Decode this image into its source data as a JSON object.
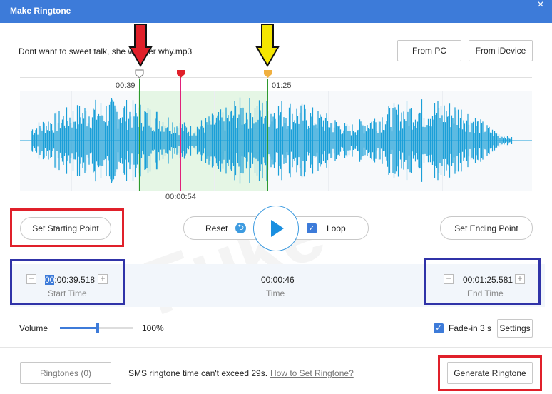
{
  "window": {
    "title": "Make Ringtone",
    "close_glyph": "×"
  },
  "file": {
    "name": "Dont want to sweet talk, she wonder why.mp3"
  },
  "source_buttons": {
    "from_pc": "From PC",
    "from_idevice": "From iDevice"
  },
  "markers": {
    "start_label": "00:39",
    "end_label": "01:25",
    "playhead_label": "00:00:54",
    "start_color": "#2e9a2e",
    "end_color": "#2e9a2e",
    "playhead_color": "#e0202a",
    "end_handle_color": "#f0b040"
  },
  "controls": {
    "set_start": "Set Starting Point",
    "set_end": "Set Ending Point",
    "reset": "Reset",
    "loop": "Loop",
    "loop_checked": true
  },
  "times": {
    "start_value": "00:00:39.518",
    "start_caption": "Start Time",
    "duration_value": "00:00:46",
    "duration_caption": "Time",
    "end_value": "00:01:25.581",
    "end_caption": "End Time",
    "minus": "−",
    "plus": "+"
  },
  "volume": {
    "label": "Volume",
    "value_text": "100%",
    "level": 0.52
  },
  "fade": {
    "label": "Fade-in 3 s",
    "checked": true,
    "settings": "Settings"
  },
  "footer": {
    "ringtones": "Ringtones (0)",
    "note": "SMS ringtone time can't exceed 29s.",
    "howto": "How to Set Ringtone?",
    "generate": "Generate Ringtone"
  },
  "watermark": "Fuke",
  "colors": {
    "accent": "#3d7bd9",
    "wave": "#1a9fd8",
    "annotation_red": "#e0202a",
    "annotation_blue": "#3033a8",
    "annotation_yellow": "#f5e600"
  }
}
